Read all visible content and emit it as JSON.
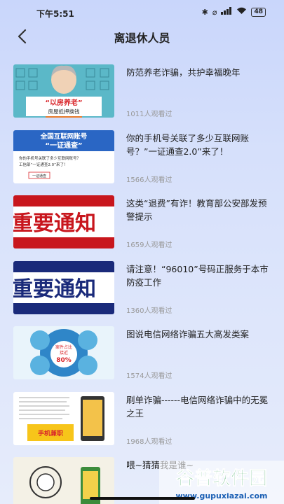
{
  "status": {
    "time": "下午5:51",
    "battery": "48"
  },
  "header": {
    "title": "离退休人员"
  },
  "items": [
    {
      "title": "防范养老诈骗，共护幸福晚年",
      "views": "1011人观看过",
      "thumb_text": [
        "“以房养老”",
        "房屋抵押换钱"
      ]
    },
    {
      "title": "你的手机号关联了多少互联网账号？”一证通查2.0”来了！",
      "views": "1566人观看过",
      "thumb_text": [
        "全国互联网账号",
        "“一证通查”",
        "你的手机号关联了多少互联网账号？",
        "工信部“一证通查2.0”来了！",
        "一证通查"
      ]
    },
    {
      "title": "这类“退费”有诈！教育部公安部发预警提示",
      "views": "1659人观看过",
      "thumb_text": [
        "重要通知"
      ]
    },
    {
      "title": "请注意！“96010”号码正服务于本市防疫工作",
      "views": "1360人观看过",
      "thumb_text": [
        "重要通知"
      ]
    },
    {
      "title": "图说电信网络诈骗五大高发类案",
      "views": "1574人观看过",
      "thumb_text": [
        "案件占比",
        "接近",
        "80%"
      ]
    },
    {
      "title": "刷单诈骗------电信网络诈骗中的无冕之王",
      "views": "1968人观看过",
      "thumb_text": [
        "手机兼职"
      ]
    },
    {
      "title": "喂~猜猜我是谁~",
      "views": "",
      "thumb_text": []
    }
  ],
  "watermark": {
    "line1": "谷普软件园",
    "line2": "www.gupuxiazai.com"
  },
  "colors": {
    "accent_red": "#d9262b",
    "navy": "#1a2a7a"
  }
}
